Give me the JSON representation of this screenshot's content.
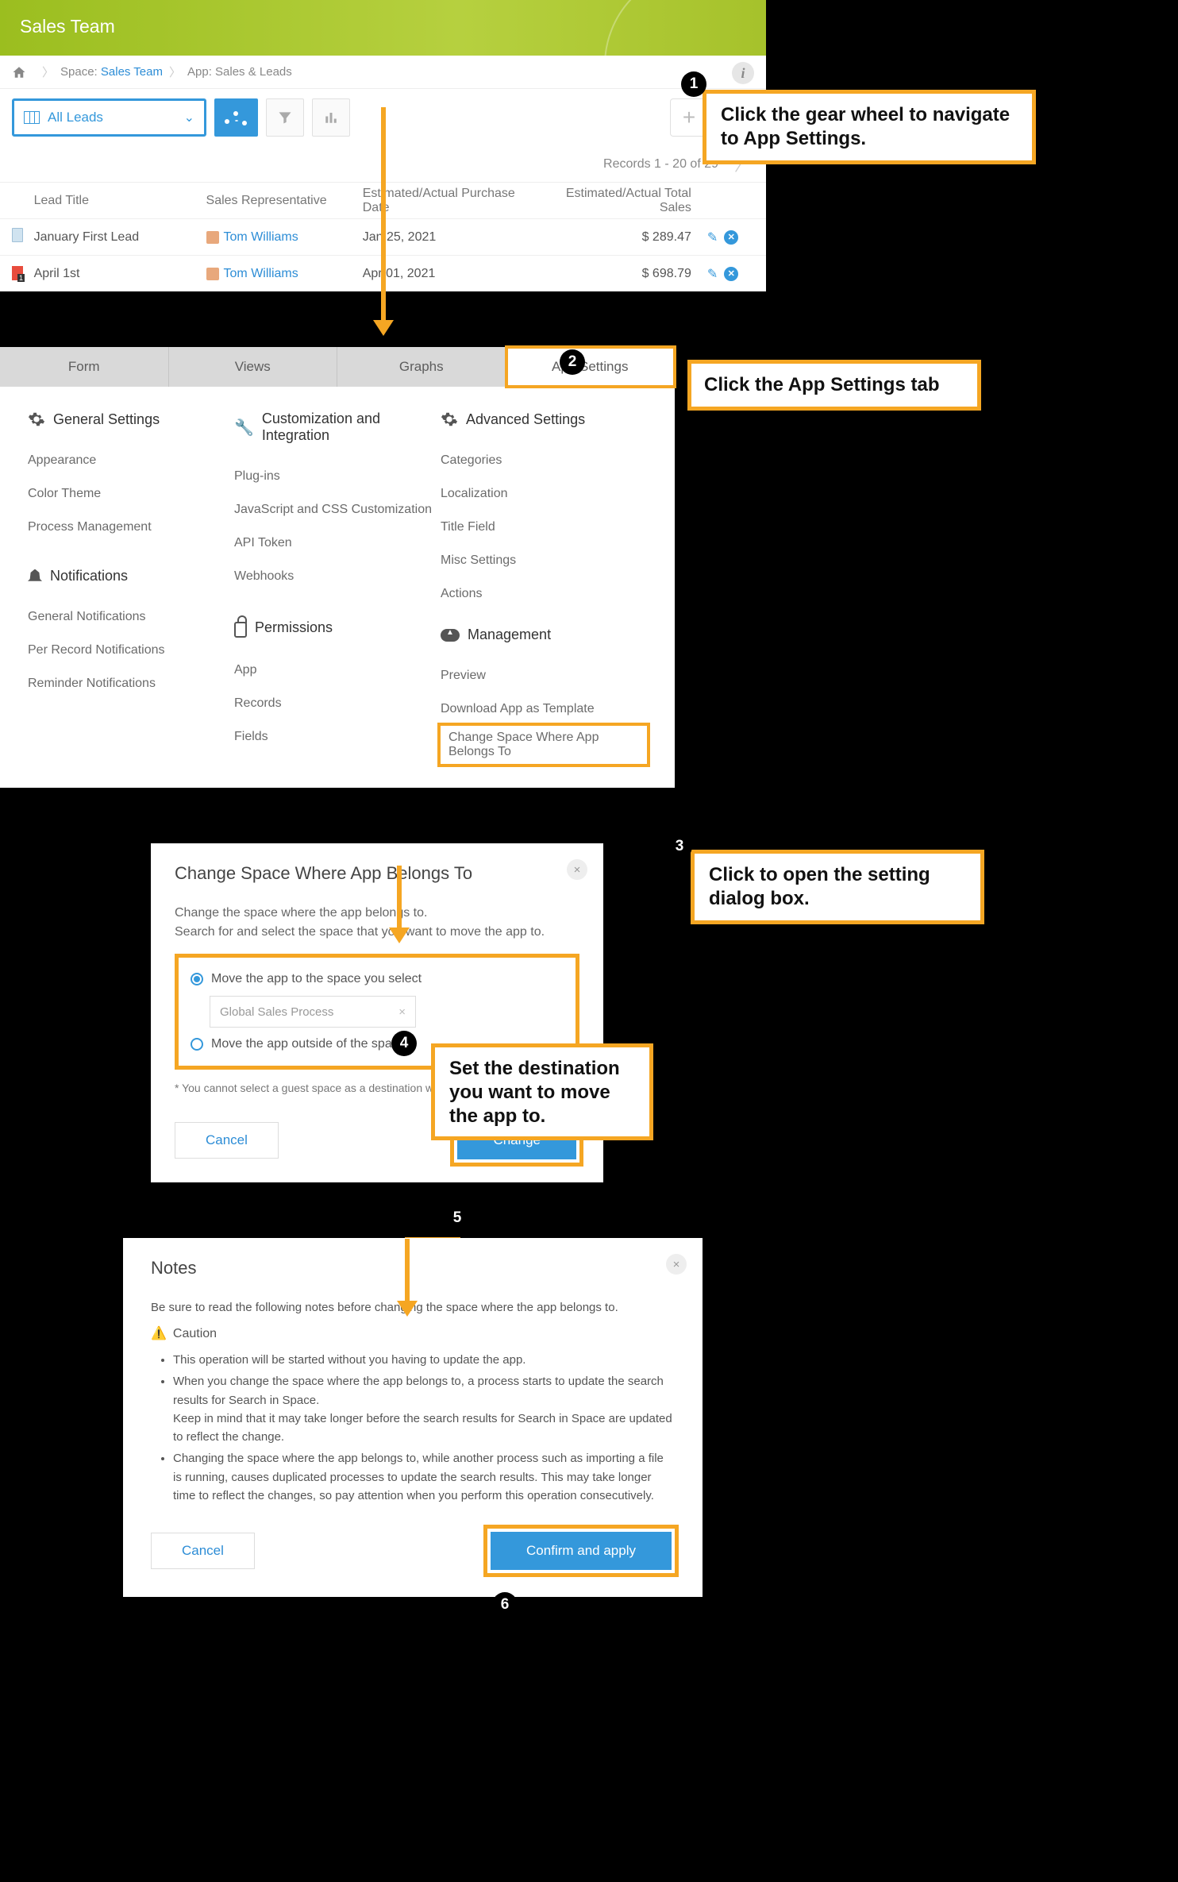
{
  "panel1": {
    "header_title": "Sales Team",
    "breadcrumbs": {
      "space_label": "Space:",
      "space_name": "Sales Team",
      "app_label": "App: Sales & Leads"
    },
    "view_name": "All Leads",
    "records_text": "Records 1 - 20 of 29",
    "columns": {
      "c1": "Lead Title",
      "c2": "Sales Representative",
      "c3": "Estimated/Actual Purchase Date",
      "c4": "Estimated/Actual Total Sales"
    },
    "rows": [
      {
        "title": "January First Lead",
        "rep": "Tom Williams",
        "date": "Jan 25, 2021",
        "total": "$ 289.47"
      },
      {
        "title": "April 1st",
        "rep": "Tom Williams",
        "date": "Apr 01, 2021",
        "total": "$ 698.79"
      }
    ]
  },
  "callouts": {
    "c1": "Click the gear wheel to navigate to App Settings.",
    "c2": "Click the App Settings tab",
    "c3": "Click to open the setting dialog box.",
    "c4": "Set the destination you want to move the app to."
  },
  "panel2": {
    "tabs": {
      "form": "Form",
      "views": "Views",
      "graphs": "Graphs",
      "settings": "App Settings"
    },
    "general": {
      "title": "General Settings",
      "items": [
        "Appearance",
        "Color Theme",
        "Process Management"
      ]
    },
    "notifications": {
      "title": "Notifications",
      "items": [
        "General Notifications",
        "Per Record Notifications",
        "Reminder Notifications"
      ]
    },
    "customization": {
      "title": "Customization and Integration",
      "items": [
        "Plug-ins",
        "JavaScript and CSS Customization",
        "API Token",
        "Webhooks"
      ]
    },
    "permissions": {
      "title": "Permissions",
      "items": [
        "App",
        "Records",
        "Fields"
      ]
    },
    "advanced": {
      "title": "Advanced Settings",
      "items": [
        "Categories",
        "Localization",
        "Title Field",
        "Misc Settings",
        "Actions"
      ]
    },
    "management": {
      "title": "Management",
      "items": [
        "Preview",
        "Download App as Template",
        "Change Space Where App Belongs To"
      ]
    }
  },
  "panel3": {
    "title": "Change Space Where App Belongs To",
    "desc1": "Change the space where the app belongs to.",
    "desc2": "Search for and select the space that you want to move the app to.",
    "opt1": "Move the app to the space you select",
    "space_value": "Global Sales Process",
    "opt2": "Move the app outside of the space",
    "note": "* You cannot select a guest space as a destination where you move the app to.",
    "cancel": "Cancel",
    "change": "Change"
  },
  "panel4": {
    "title": "Notes",
    "intro": "Be sure to read the following notes before changing the space where the app belongs to.",
    "caution": "Caution",
    "bullets": [
      "This operation will be started without you having to update the app.",
      "When you change the space where the app belongs to, a process starts to update the search results for Search in Space.\nKeep in mind that it may take longer before the search results for Search in Space are updated to reflect the change.",
      "Changing the space where the app belongs to, while another process such as importing a file is running, causes duplicated processes to update the search results. This may take longer time to reflect the changes, so pay attention when you perform this operation consecutively."
    ],
    "cancel": "Cancel",
    "confirm": "Confirm and apply"
  }
}
